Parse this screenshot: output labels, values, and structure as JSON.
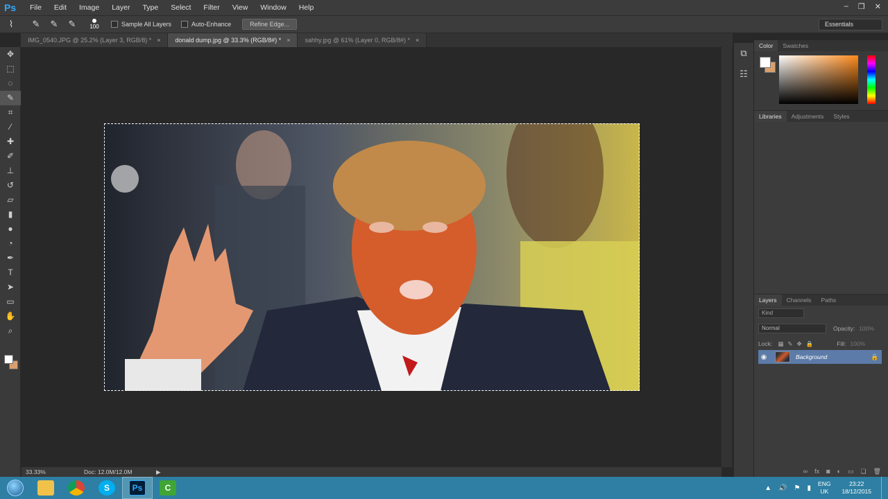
{
  "app": {
    "logo": "Ps",
    "menu": [
      "File",
      "Edit",
      "Image",
      "Layer",
      "Type",
      "Select",
      "Filter",
      "View",
      "Window",
      "Help"
    ],
    "window_controls": [
      "–",
      "❐",
      "✕"
    ]
  },
  "options_bar": {
    "brush_size": "100",
    "sample_all_layers": "Sample All Layers",
    "auto_enhance": "Auto-Enhance",
    "refine_edge": "Refine Edge...",
    "workspace": "Essentials"
  },
  "tabs": [
    {
      "label": "IMG_0540.JPG @ 25.2% (Layer 3, RGB/8) *"
    },
    {
      "label": "donald dump.jpg @ 33.3% (RGB/8#) *"
    },
    {
      "label": "sahhy.jpg @ 61% (Layer 0, RGB/8#) *"
    }
  ],
  "tab_close": "×",
  "tools": [
    "move-icon",
    "marquee-icon",
    "lasso-icon",
    "quick-selection-icon",
    "crop-icon",
    "eyedropper-icon",
    "healing-brush-icon",
    "brush-icon",
    "clone-stamp-icon",
    "history-brush-icon",
    "eraser-icon",
    "gradient-icon",
    "blur-icon",
    "dodge-icon",
    "pen-icon",
    "type-icon",
    "path-selection-icon",
    "rectangle-icon",
    "hand-icon",
    "zoom-icon"
  ],
  "status": {
    "zoom": "33.33%",
    "doc": "Doc: 12.0M/12.0M"
  },
  "color_panel": {
    "tabs": [
      "Color",
      "Swatches"
    ],
    "foreground": "#ffffff",
    "background": "#d9a06c"
  },
  "libraries_panel": {
    "tabs": [
      "Libraries",
      "Adjustments",
      "Styles"
    ]
  },
  "layers_panel": {
    "tabs": [
      "Layers",
      "Channels",
      "Paths"
    ],
    "filter": "Kind",
    "blend_mode": "Normal",
    "opacity_label": "Opacity:",
    "opacity_value": "100%",
    "lock_label": "Lock:",
    "fill_label": "Fill:",
    "fill_value": "100%",
    "layers": [
      {
        "name": "Background",
        "locked": true
      }
    ]
  },
  "taskbar": {
    "apps": [
      "explorer",
      "chrome",
      "skype",
      "photoshop",
      "camtasia"
    ],
    "photoshop_label": "Ps",
    "language": "ENG",
    "region": "UK",
    "time": "23:22",
    "date": "18/12/2015"
  },
  "colors": {
    "accent_ps": "#31a8ff",
    "taskbar": "#2e7fa3",
    "layer_selected": "#5c7ba8"
  }
}
